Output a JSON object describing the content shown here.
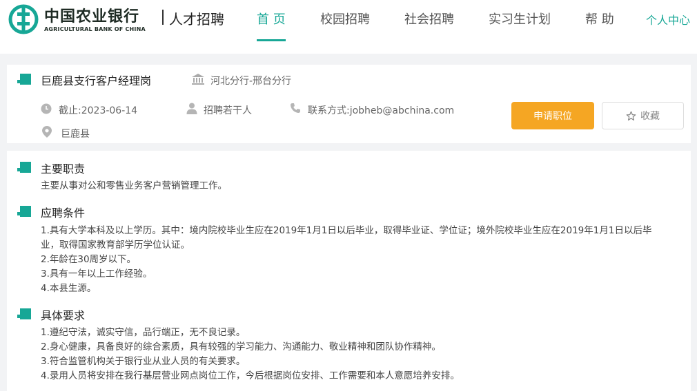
{
  "header": {
    "brand_cn": "中国农业银行",
    "brand_en": "AGRICULTURAL BANK OF CHINA",
    "brand_sub": "人才招聘",
    "nav": [
      "首 页",
      "校园招聘",
      "社会招聘",
      "实习生计划",
      "帮 助"
    ],
    "active_nav": "首 页",
    "user_center": "个人中心",
    "brand_color": "#17a796"
  },
  "job": {
    "title": "巨鹿县支行客户经理岗",
    "branch": "河北分行-邢台分行",
    "deadline": "截止:2023-06-14",
    "headcount": "招聘若干人",
    "contact": "联系方式:jobheb@abchina.com",
    "location": "巨鹿县",
    "apply_label": "申请职位",
    "favorite_label": "收藏",
    "apply_color": "#f5a623"
  },
  "sections": {
    "duties": {
      "title": "主要职责",
      "lines": [
        "主要从事对公和零售业务客户营销管理工作。"
      ]
    },
    "conditions": {
      "title": "应聘条件",
      "lines": [
        "1.具有大学本科及以上学历。其中：境内院校毕业生应在2019年1月1日以后毕业，取得毕业证、学位证；境外院校毕业生应在2019年1月1日以后毕",
        "业，取得国家教育部学历学位认证。",
        "2.年龄在30周岁以下。",
        "3.具有一年以上工作经验。",
        "4.本县生源。"
      ]
    },
    "requirements": {
      "title": "具体要求",
      "lines": [
        "1.遵纪守法，诚实守信，品行端正，无不良记录。",
        "2.身心健康，具备良好的综合素质，具有较强的学习能力、沟通能力、敬业精神和团队协作精神。",
        "3.符合监管机构关于银行业从业人员的有关要求。",
        "4.录用人员将安排在我行基层营业网点岗位工作，今后根据岗位安排、工作需要和本人意愿培养安排。"
      ]
    }
  }
}
